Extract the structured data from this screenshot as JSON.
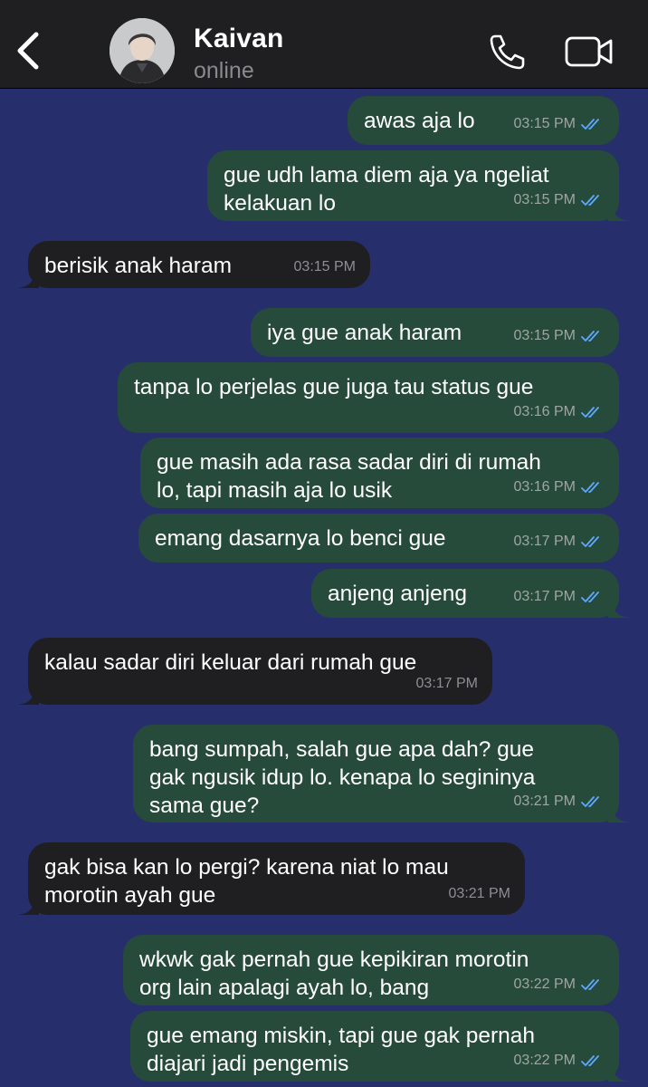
{
  "header": {
    "contact_name": "Kaivan",
    "status": "online",
    "icons": [
      "chevron-left-icon",
      "avatar",
      "phone-icon",
      "video-camera-icon"
    ]
  },
  "colors": {
    "chat_background": "#262f6c",
    "outgoing_bubble": "#274b3b",
    "incoming_bubble": "#1f1f21",
    "read_ticks": "#5ea8ff"
  },
  "messages": [
    {
      "dir": "out",
      "text": "awas aja lo",
      "time": "03:15 PM"
    },
    {
      "dir": "out",
      "text": "gue udh lama diem aja ya ngeliat\nkelakuan lo",
      "time": "03:15 PM"
    },
    {
      "dir": "in",
      "text": "berisik anak haram",
      "time": "03:15 PM"
    },
    {
      "dir": "out",
      "text": "iya gue anak haram",
      "time": "03:15 PM"
    },
    {
      "dir": "out",
      "text": "tanpa lo perjelas gue juga tau status gue",
      "time": "03:16 PM"
    },
    {
      "dir": "out",
      "text": "gue masih ada rasa sadar diri di rumah\nlo, tapi masih aja lo usik",
      "time": "03:16 PM"
    },
    {
      "dir": "out",
      "text": "emang dasarnya lo benci gue",
      "time": "03:17 PM"
    },
    {
      "dir": "out",
      "text": "anjeng anjeng",
      "time": "03:17 PM"
    },
    {
      "dir": "in",
      "text": "kalau sadar diri keluar dari rumah gue",
      "time": "03:17 PM"
    },
    {
      "dir": "out",
      "text": "bang sumpah, salah gue apa dah? gue\ngak ngusik idup lo. kenapa lo segininya\nsama gue?",
      "time": "03:21 PM"
    },
    {
      "dir": "in",
      "text": "gak bisa kan lo pergi? karena niat lo mau\nmorotin ayah gue",
      "time": "03:21 PM"
    },
    {
      "dir": "out",
      "text": "wkwk gak pernah gue kepikiran morotin\norg lain apalagi ayah lo, bang",
      "time": "03:22 PM"
    },
    {
      "dir": "out",
      "text": "gue emang miskin, tapi gue gak pernah\ndiajari jadi pengemis",
      "time": "03:22 PM"
    }
  ]
}
